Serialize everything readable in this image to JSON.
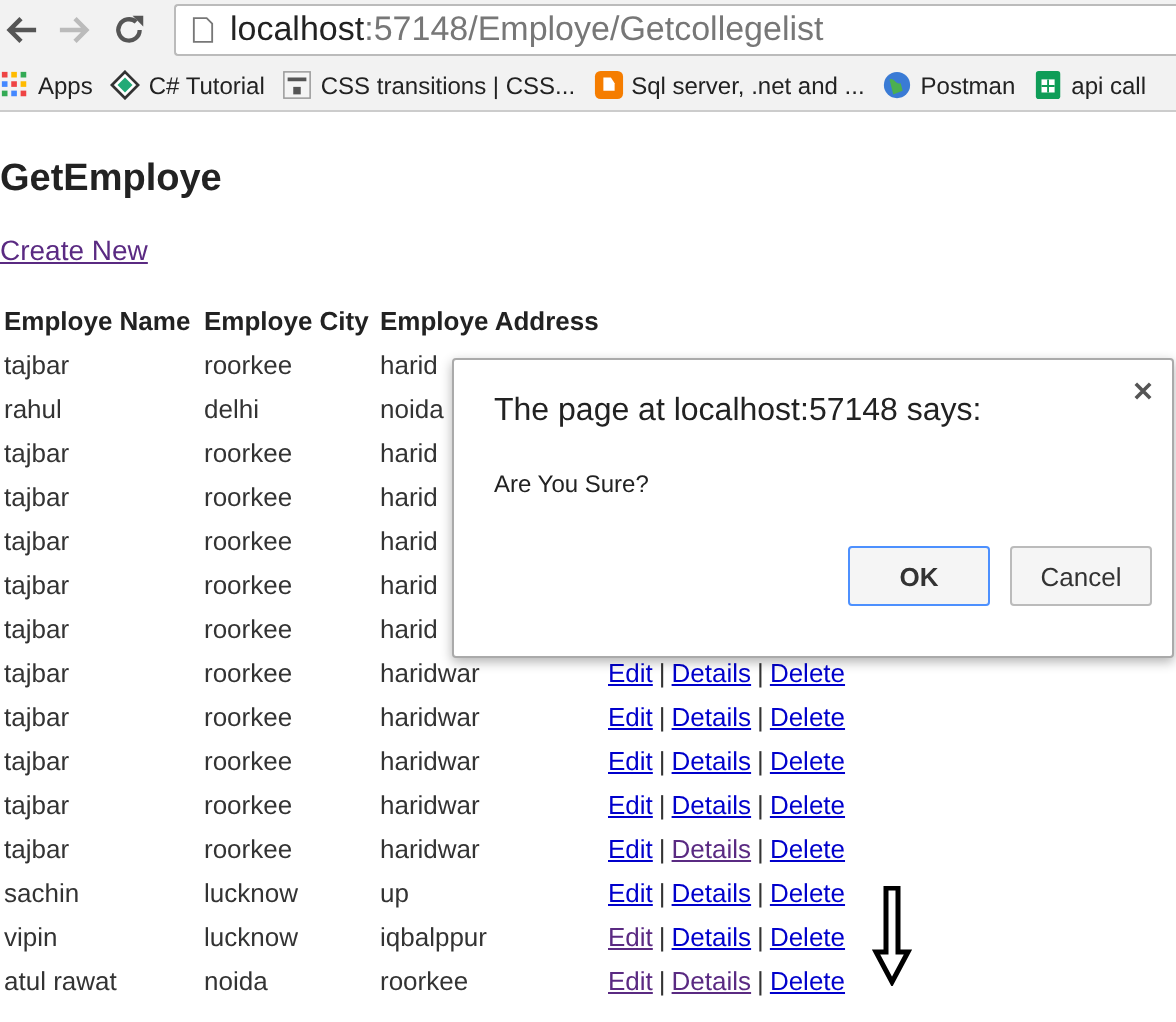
{
  "browser": {
    "url_host": "localhost",
    "url_path": ":57148/Employe/Getcollegelist",
    "bookmarks": [
      {
        "label": "Apps",
        "kind": "apps"
      },
      {
        "label": "C# Tutorial",
        "kind": "diamond"
      },
      {
        "label": "CSS transitions | CSS...",
        "kind": "css"
      },
      {
        "label": "Sql server, .net and ...",
        "kind": "blogger"
      },
      {
        "label": "Postman",
        "kind": "globe"
      },
      {
        "label": "api call",
        "kind": "sheet"
      }
    ]
  },
  "page": {
    "title": "GetEmploye",
    "create_link": {
      "label": "Create New",
      "visited": true
    },
    "table": {
      "columns": [
        "Employe Name",
        "Employe City",
        "Employe Address"
      ],
      "rows": [
        {
          "name": "tajbar",
          "city": "roorkee",
          "address": "harid"
        },
        {
          "name": "rahul",
          "city": "delhi",
          "address": "noida"
        },
        {
          "name": "tajbar",
          "city": "roorkee",
          "address": "harid"
        },
        {
          "name": "tajbar",
          "city": "roorkee",
          "address": "harid"
        },
        {
          "name": "tajbar",
          "city": "roorkee",
          "address": "harid"
        },
        {
          "name": "tajbar",
          "city": "roorkee",
          "address": "harid"
        },
        {
          "name": "tajbar",
          "city": "roorkee",
          "address": "harid"
        },
        {
          "name": "tajbar",
          "city": "roorkee",
          "address": "haridwar",
          "links": [
            {
              "kind": "link",
              "label": "Edit",
              "visited": false
            },
            {
              "kind": "separator",
              "label": "|"
            },
            {
              "kind": "link",
              "label": "Details",
              "visited": false
            },
            {
              "kind": "separator",
              "label": "|"
            },
            {
              "kind": "link",
              "label": "Delete",
              "visited": false
            }
          ]
        },
        {
          "name": "tajbar",
          "city": "roorkee",
          "address": "haridwar",
          "links": [
            {
              "kind": "link",
              "label": "Edit",
              "visited": false
            },
            {
              "kind": "separator",
              "label": "|"
            },
            {
              "kind": "link",
              "label": "Details",
              "visited": false
            },
            {
              "kind": "separator",
              "label": "|"
            },
            {
              "kind": "link",
              "label": "Delete",
              "visited": false
            }
          ]
        },
        {
          "name": "tajbar",
          "city": "roorkee",
          "address": "haridwar",
          "links": [
            {
              "kind": "link",
              "label": "Edit",
              "visited": false
            },
            {
              "kind": "separator",
              "label": "|"
            },
            {
              "kind": "link",
              "label": "Details",
              "visited": false
            },
            {
              "kind": "separator",
              "label": "|"
            },
            {
              "kind": "link",
              "label": "Delete",
              "visited": false
            }
          ]
        },
        {
          "name": "tajbar",
          "city": "roorkee",
          "address": "haridwar",
          "links": [
            {
              "kind": "link",
              "label": "Edit",
              "visited": false
            },
            {
              "kind": "separator",
              "label": "|"
            },
            {
              "kind": "link",
              "label": "Details",
              "visited": false
            },
            {
              "kind": "separator",
              "label": "|"
            },
            {
              "kind": "link",
              "label": "Delete",
              "visited": false
            }
          ]
        },
        {
          "name": "tajbar",
          "city": "roorkee",
          "address": "haridwar",
          "links": [
            {
              "kind": "link",
              "label": "Edit",
              "visited": false
            },
            {
              "kind": "separator",
              "label": "|"
            },
            {
              "kind": "link",
              "label": "Details",
              "visited": true
            },
            {
              "kind": "separator",
              "label": "|"
            },
            {
              "kind": "link",
              "label": "Delete",
              "visited": false
            }
          ]
        },
        {
          "name": "sachin",
          "city": "lucknow",
          "address": "up",
          "links": [
            {
              "kind": "link",
              "label": "Edit",
              "visited": false
            },
            {
              "kind": "separator",
              "label": "|"
            },
            {
              "kind": "link",
              "label": "Details",
              "visited": false
            },
            {
              "kind": "separator",
              "label": "|"
            },
            {
              "kind": "link",
              "label": "Delete",
              "visited": false
            }
          ]
        },
        {
          "name": "vipin",
          "city": "lucknow",
          "address": "iqbalppur",
          "links": [
            {
              "kind": "link",
              "label": "Edit",
              "visited": true
            },
            {
              "kind": "separator",
              "label": "|"
            },
            {
              "kind": "link",
              "label": "Details",
              "visited": false
            },
            {
              "kind": "separator",
              "label": "|"
            },
            {
              "kind": "link",
              "label": "Delete",
              "visited": false
            }
          ]
        },
        {
          "name": "atul rawat",
          "city": "noida",
          "address": "roorkee",
          "links": [
            {
              "kind": "link",
              "label": "Edit",
              "visited": true
            },
            {
              "kind": "separator",
              "label": "|"
            },
            {
              "kind": "link",
              "label": "Details",
              "visited": true
            },
            {
              "kind": "separator",
              "label": "|"
            },
            {
              "kind": "link",
              "label": "Delete",
              "visited": false
            }
          ]
        }
      ]
    }
  },
  "dialog": {
    "title": "The page at localhost:57148 says:",
    "message": "Are You Sure?",
    "buttons": [
      {
        "label": "OK",
        "selected": true
      },
      {
        "label": "Cancel",
        "selected": false
      }
    ]
  }
}
